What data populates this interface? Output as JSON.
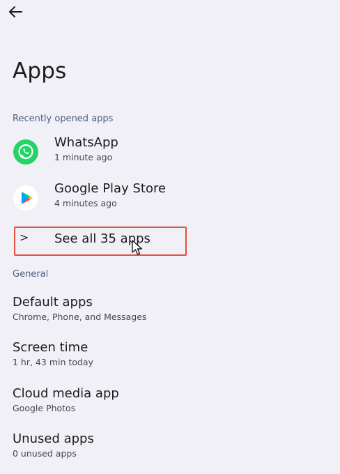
{
  "header": {
    "back_icon": "arrow-left-icon",
    "title": "Apps"
  },
  "recent": {
    "section_label": "Recently opened apps",
    "apps": [
      {
        "name": "WhatsApp",
        "time": "1 minute ago",
        "icon": "whatsapp-icon",
        "color": "#25d366"
      },
      {
        "name": "Google Play Store",
        "time": "4 minutes ago",
        "icon": "google-play-icon",
        "color": "#ffffff"
      }
    ],
    "see_all_label": "See all 35 apps",
    "see_all_icon": "chevron-right-icon",
    "highlight_color": "#e0523f"
  },
  "general": {
    "section_label": "General",
    "items": [
      {
        "title": "Default apps",
        "subtitle": "Chrome, Phone, and Messages"
      },
      {
        "title": "Screen time",
        "subtitle": "1 hr, 43 min today"
      },
      {
        "title": "Cloud media app",
        "subtitle": "Google Photos"
      },
      {
        "title": "Unused apps",
        "subtitle": "0 unused apps"
      }
    ]
  },
  "colors": {
    "background": "#f0f0f6",
    "section_header": "#4e5c84"
  }
}
